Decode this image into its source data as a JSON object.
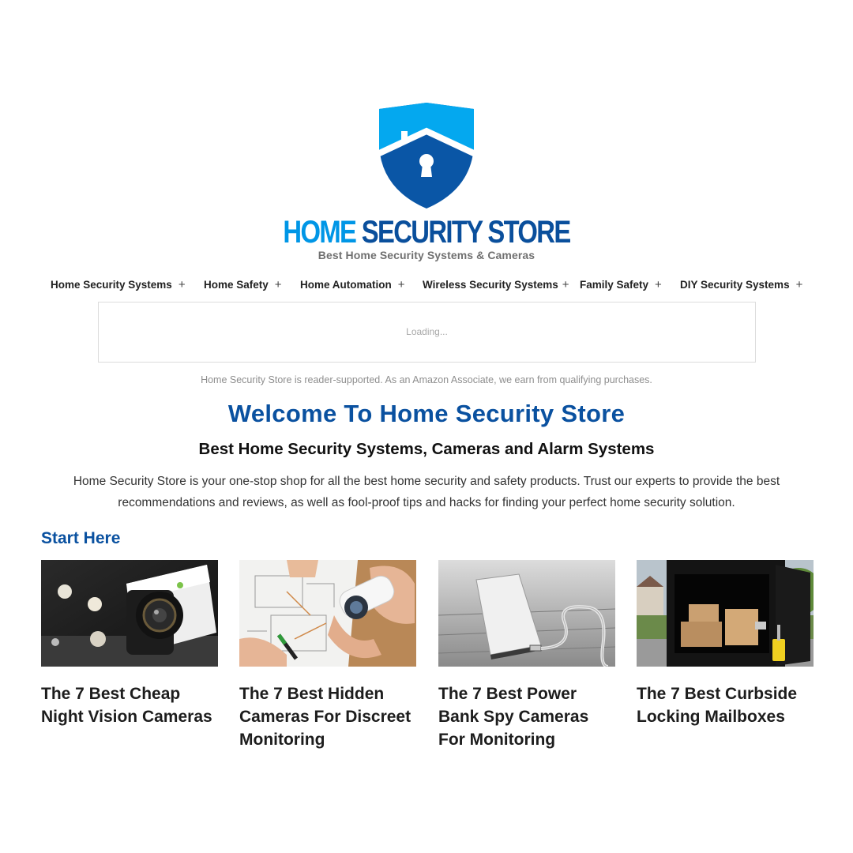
{
  "brand": {
    "name_part1": "HOME",
    "name_part2": "SECURITY STORE",
    "tagline": "Best Home Security Systems & Cameras",
    "colors": {
      "light_blue": "#0096e6",
      "dark_blue": "#0a4f9c",
      "shield_top": "#04a8ef",
      "shield_bottom": "#0a56a6"
    }
  },
  "nav": {
    "items": [
      {
        "label": "Home Security Systems",
        "expand": "+"
      },
      {
        "label": "Home Safety",
        "expand": "+"
      },
      {
        "label": "Home Automation",
        "expand": "+"
      },
      {
        "label": "Wireless Security Systems",
        "expand": "+"
      },
      {
        "label": "Family Safety",
        "expand": "+"
      },
      {
        "label": "DIY Security Systems",
        "expand": "+"
      }
    ]
  },
  "search_widget": {
    "loading_text": "Loading..."
  },
  "disclaimer": "Home Security Store is reader-supported. As an Amazon Associate, we earn from qualifying purchases.",
  "main": {
    "welcome_title": "Welcome To Home Security Store",
    "subtitle": "Best Home Security Systems, Cameras and Alarm Systems",
    "intro": "Home Security Store is your one-stop shop for all the best home security and safety products. Trust our experts to provide the best recommendations and reviews, as well as fool-proof tips and hacks for finding your perfect home security solution.",
    "start_here": "Start Here",
    "accent_color": "#0a51a0"
  },
  "articles": [
    {
      "title": "The 7 Best Cheap Night Vision Cameras",
      "image": "night-vision-camera-image"
    },
    {
      "title": "The 7 Best Hidden Cameras For Discreet Monitoring",
      "image": "hidden-camera-image"
    },
    {
      "title": "The 7 Best Power Bank Spy Cameras For Monitoring",
      "image": "power-bank-image"
    },
    {
      "title": "The 7 Best Curbside Locking Mailboxes",
      "image": "locking-mailbox-image"
    }
  ]
}
